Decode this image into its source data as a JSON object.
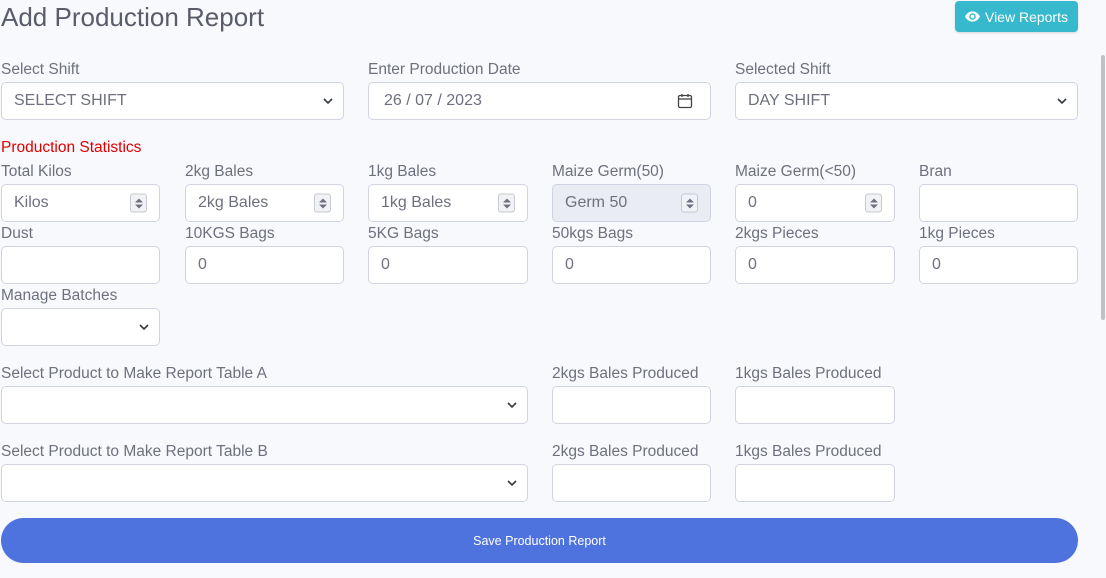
{
  "header": {
    "title": "Add Production Report",
    "view_reports_label": "View Reports",
    "view_reports_icon": "eye-icon"
  },
  "shift": {
    "select_shift_label": "Select Shift",
    "select_shift_value": "SELECT SHIFT",
    "date_label": "Enter Production Date",
    "date_value": "26 / 07 / 2023",
    "selected_shift_label": "Selected Shift",
    "selected_shift_value": "DAY SHIFT"
  },
  "stats": {
    "heading": "Production Statistics",
    "total_kilos_label": "Total Kilos",
    "total_kilos_placeholder": "Kilos",
    "bales2_label": "2kg Bales",
    "bales2_placeholder": "2kg Bales",
    "bales1_label": "1kg Bales",
    "bales1_placeholder": "1kg Bales",
    "germ50_label": "Maize Germ(50)",
    "germ50_placeholder": "Germ 50",
    "germlt50_label": "Maize Germ(<50)",
    "germlt50_value": "0",
    "bran_label": "Bran",
    "bran_value": "",
    "dust_label": "Dust",
    "dust_value": "",
    "bags10_label": "10KGS Bags",
    "bags10_value": "0",
    "bags5_label": "5KG Bags",
    "bags5_value": "0",
    "bags50_label": "50kgs Bags",
    "bags50_value": "0",
    "pieces2_label": "2kgs Pieces",
    "pieces2_value": "0",
    "pieces1_label": "1kg Pieces",
    "pieces1_value": "0"
  },
  "batches": {
    "label": "Manage Batches",
    "value": ""
  },
  "table_a": {
    "label": "Select Product to Make Report Table A",
    "value": "",
    "bales2_label": "2kgs Bales Produced",
    "bales2_value": "",
    "bales1_label": "1kgs Bales Produced",
    "bales1_value": ""
  },
  "table_b": {
    "label": "Select Product to Make Report Table B",
    "value": "",
    "bales2_label": "2kgs Bales Produced",
    "bales2_value": "",
    "bales1_label": "1kgs Bales Produced",
    "bales1_value": ""
  },
  "footer": {
    "save_label": "Save Production Report"
  },
  "colors": {
    "primary": "#4e73df",
    "info": "#36b9cc",
    "section_heading": "#e00000",
    "text": "#6e707e",
    "border": "#d1d3e2"
  }
}
